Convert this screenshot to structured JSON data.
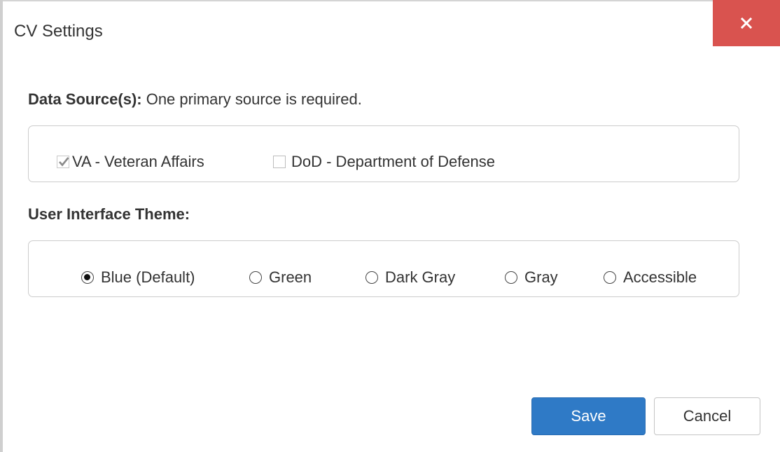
{
  "dialog": {
    "title": "CV Settings",
    "close_glyph": "×",
    "close_icon": "close-icon",
    "accent_color": "#d9534f"
  },
  "data_source": {
    "label_bold": "Data Source(s):",
    "label_rest": " One primary source is required.",
    "options": [
      {
        "label": "VA - Veteran Affairs",
        "checked": true
      },
      {
        "label": "DoD - Department of Defense",
        "checked": false
      }
    ]
  },
  "theme": {
    "label": "User Interface Theme:",
    "options": [
      {
        "label": "Blue (Default)",
        "selected": true
      },
      {
        "label": "Green",
        "selected": false
      },
      {
        "label": "Dark Gray",
        "selected": false
      },
      {
        "label": "Gray",
        "selected": false
      },
      {
        "label": "Accessible",
        "selected": false
      }
    ]
  },
  "buttons": {
    "save_label": "Save",
    "cancel_label": "Cancel",
    "save_color": "#2f7ac6"
  }
}
